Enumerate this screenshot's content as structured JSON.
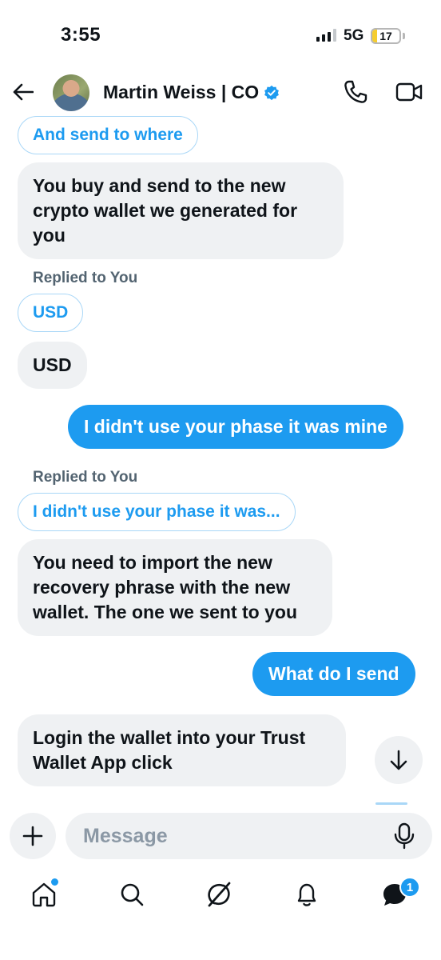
{
  "status_bar": {
    "time": "3:55",
    "network": "5G",
    "battery": "17",
    "battery_level": 0.17
  },
  "header": {
    "contact_name": "Martin Weiss | CO",
    "verified": true
  },
  "messages": {
    "m1_quote": "And send to where",
    "m1_text": "You buy and send to the new crypto wallet we generated for you",
    "m2_replied": "Replied to You",
    "m2_quote": "USD",
    "m2_text": "USD",
    "m3_out": "I didn't use your phase it was mine",
    "m4_replied": "Replied to You",
    "m4_quote": "I didn't use your phase it was...",
    "m4_text": "You need to import the new recovery phrase with the new wallet. The one we sent to you",
    "m5_out": "What do I send",
    "m6_text": "Login the wallet into your Trust Wallet App click"
  },
  "composer": {
    "placeholder": "Message"
  },
  "tabbar": {
    "messages_badge": "1"
  },
  "colors": {
    "accent": "#1d9bf0",
    "incoming_bubble": "#eff1f3",
    "text": "#0f1419",
    "muted": "#536471"
  }
}
